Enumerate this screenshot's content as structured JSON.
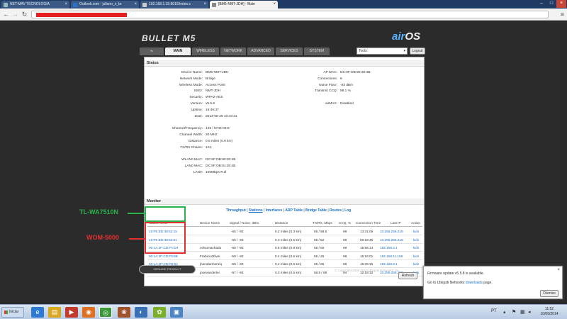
{
  "browser": {
    "tabs": [
      {
        "title": "NET-MAV TECNOLOGIA",
        "active": false
      },
      {
        "title": "Outlook.com - juliano_v_br",
        "active": false
      },
      {
        "title": "192.168.1.15:8015/index.c",
        "active": false
      },
      {
        "title": "[BM5-NMT-JDH] - Main",
        "active": true
      }
    ],
    "window_controls": [
      "minimize",
      "maximize",
      "close"
    ]
  },
  "airos": {
    "brand_left": "BULLET M5",
    "brand_right_air": "air",
    "brand_right_os": "OS",
    "tabs": [
      "MAIN",
      "WIRELESS",
      "NETWORK",
      "ADVANCED",
      "SERVICES",
      "SYSTEM"
    ],
    "tools_select": "Tools:",
    "logout": "Logout",
    "status_title": "Status",
    "status_left": [
      {
        "label": "Device Name:",
        "value": "BM5-NMT-JDH"
      },
      {
        "label": "Network Mode:",
        "value": "Bridge"
      },
      {
        "label": "Wireless Mode:",
        "value": "Access Point"
      },
      {
        "label": "SSID:",
        "value": "NMT-JDH"
      },
      {
        "label": "Security:",
        "value": "WPA2-AES"
      },
      {
        "label": "Version:",
        "value": "v5.5.6"
      },
      {
        "label": "Uptime:",
        "value": "16:46:47"
      },
      {
        "label": "Date:",
        "value": "2013-05-29 10:43:41"
      },
      {
        "label": "Channel/Frequency:",
        "value": "149 / 5745 MHz"
      },
      {
        "label": "Channel Width:",
        "value": "20 MHz"
      },
      {
        "label": "Distance:",
        "value": "0.6 miles (0.9 km)"
      },
      {
        "label": "TX/RX Chains:",
        "value": "1X1"
      },
      {
        "label": "WLAN0 MAC:",
        "value": "DC:9F:DB:90:30:4B"
      },
      {
        "label": "LAN0 MAC:",
        "value": "DC:9F:DB:91:30:4B"
      },
      {
        "label": "LAN0:",
        "value": "100Mbps-Full"
      }
    ],
    "status_right": [
      {
        "label": "AP MAC:",
        "value": "DC:9F:DB:90:30:4B"
      },
      {
        "label": "Connections:",
        "value": "6"
      },
      {
        "label": "Noise Floor:",
        "value": "-93 dBm"
      },
      {
        "label": "Transmit CCQ:",
        "value": "98.1 %"
      },
      {
        "label": "airMAX:",
        "value": "Disabled"
      }
    ],
    "monitor_title": "Monitor",
    "monitor_links": [
      "Throughput",
      "Stations",
      "Interfaces",
      "ARP Table",
      "Bridge Table",
      "Routes",
      "Log"
    ],
    "table_headers": [
      "Station MAC",
      "Device Name",
      "Signal / Noise, dBm",
      "Distance",
      "TX/RX, Mbps",
      "CCQ, %",
      "Connection Time",
      "Last IP",
      "Action"
    ],
    "stations": [
      {
        "mac": "10:FE:ED:38:62:15",
        "name": "",
        "signal": "-65 / -93",
        "distance": "0.2 miles (0.3 km)",
        "txrx": "65 / 58.5",
        "ccq": "99",
        "time": "13:31:06",
        "ip": "10.255.255.219",
        "action": "kick"
      },
      {
        "mac": "10:FE:ED:38:62:01",
        "name": "",
        "signal": "-65 / -93",
        "distance": "0.3 miles (0.5 km)",
        "txrx": "65 / 52",
        "ccq": "99",
        "time": "00:18:45",
        "ip": "10.255.255.218",
        "action": "kick"
      },
      {
        "mac": "00:1A:3F:CD:FA:D4",
        "name": "celsomachado",
        "signal": "-60 / -93",
        "distance": "0.6 miles (0.9 km)",
        "txrx": "65 / 65",
        "ccq": "99",
        "time": "15:56:14",
        "ip": "192.168.2.1",
        "action": "kick"
      },
      {
        "mac": "00:1A:3F:CD:F9:8B",
        "name": "FrabicioOlivei",
        "signal": "-59 / -93",
        "distance": "0.4 miles (0.6 km)",
        "txrx": "65 / 26",
        "ccq": "98",
        "time": "16:16:01",
        "ip": "192.168.11.155",
        "action": "kick"
      },
      {
        "mac": "00:1A:3F:CD:FB:54",
        "name": "jhonatanhenriq",
        "signal": "-59 / -93",
        "distance": "0.4 miles (0.6 km)",
        "txrx": "65 / 65",
        "ccq": "98",
        "time": "16:25:15",
        "ip": "192.168.2.1",
        "action": "kick"
      },
      {
        "mac": "00:1A:3F:B3:75:8C",
        "name": "josevanderlei",
        "signal": "-57 / -93",
        "distance": "0.3 miles (0.5 km)",
        "txrx": "58.5 / 65",
        "ccq": "94",
        "time": "12:18:32",
        "ip": "10.255.255.197",
        "action": "kick"
      }
    ],
    "refresh": "Refresh",
    "genuine": "GENUINE PRODUCT",
    "copyright": "© Copyright 2006-2013 Ubiquiti Networks, Inc."
  },
  "annotations": {
    "green_label": "TL-WA7510N",
    "red_label": "WOM-5000",
    "green_color": "#2bb24c",
    "red_color": "#e03030"
  },
  "notification": {
    "line1": "Firmware update v5.5.8 is available.",
    "line2_prefix": "Go to Ubiquiti Networks",
    "line2_link": "downloads",
    "line2_suffix": "page.",
    "dismiss": "Dismiss"
  },
  "taskbar": {
    "start": "Iniciar",
    "lang": "PT",
    "time": "11:52",
    "date": "10/06/2014"
  }
}
